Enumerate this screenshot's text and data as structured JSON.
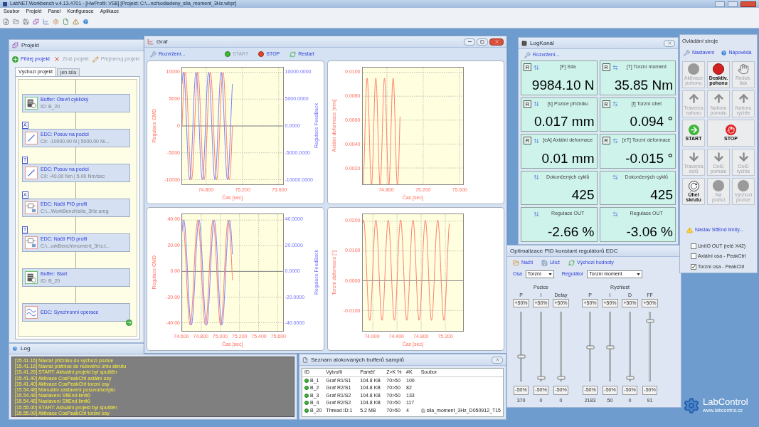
{
  "app": {
    "title": "LabNET.Workbench v.4.13.4701 -  [HwProfil: VS8] [Projekt: C:\\...nch\\odladeny_sila_moment_3Hz.wbpr]",
    "menu": [
      "Soubor",
      "Projekt",
      "Panel",
      "Konfigurace",
      "Aplikace"
    ]
  },
  "project": {
    "title": "Projekt",
    "actions": [
      {
        "label": "Přidej projekt",
        "kind": "add",
        "disabled": false
      },
      {
        "label": "Zruš projekt",
        "kind": "remove",
        "disabled": true
      },
      {
        "label": "Přejmenuj projekt",
        "kind": "rename",
        "disabled": true
      }
    ],
    "tabs": [
      {
        "label": "Výchozí projekt",
        "selected": true
      },
      {
        "label": "jen síla",
        "selected": false
      }
    ],
    "nodes": [
      {
        "kind": "buffer",
        "title": "Buffer: Otevři cyklický",
        "detail": "ID: B_20"
      },
      {
        "badge": "A",
        "kind": "move",
        "title": "EDC: Posuv na pozici",
        "detail": "Cíl: -10000.00 N | 5000.00 N/..."
      },
      {
        "badge": "T",
        "kind": "move",
        "title": "EDC: Posuv na pozici",
        "detail": "Cíl: -40.00 Nm | 5.00 Nm/sec"
      },
      {
        "badge": "A",
        "kind": "pid",
        "title": "EDC: Načti PID profil",
        "detail": "C:\\...WorkBench\\sila_3Hz.areg"
      },
      {
        "badge": "T",
        "kind": "pid",
        "title": "EDC: Načti PID profil",
        "detail": "C:\\...orkBench\\moment_3Hz.t..."
      },
      {
        "kind": "buffer",
        "title": "Buffer: Start",
        "detail": "ID: B_20"
      },
      {
        "kind": "sync",
        "title": "EDC: Synchronní operace",
        "next": true
      }
    ]
  },
  "graph": {
    "title": "Graf",
    "actions": [
      {
        "label": "Rozvržení...",
        "kind": "layout",
        "disabled": false
      },
      {
        "label": "START",
        "kind": "start",
        "disabled": true
      },
      {
        "label": "STOP",
        "kind": "stop",
        "disabled": false
      },
      {
        "label": "Restart",
        "kind": "restart",
        "disabled": false
      }
    ],
    "charts": [
      {
        "kind": "dual",
        "left_axis": {
          "title": "Regulace CMD",
          "ticks": [
            "10000",
            "5000",
            "0",
            "-5000",
            "-10000"
          ]
        },
        "right_axis": {
          "title": "Regulace FeedBack",
          "ticks": [
            "10000.0000",
            "5000.0000",
            "0.0000",
            "-5000.0000",
            "-10000.0000"
          ]
        },
        "bottom_axis": {
          "title": "Čas [sec]",
          "ticks": [
            "74.800",
            "75.200",
            "75.600"
          ]
        }
      },
      {
        "kind": "single",
        "left_axis": {
          "title": "Axiální deformace [mm]",
          "ticks": [
            "0.0100",
            "0.0080",
            "0.0060",
            "0.0040",
            "0.0020"
          ]
        },
        "bottom_axis": {
          "title": "Čas [sec]",
          "ticks": [
            "74.800",
            "75.200",
            "75.600"
          ]
        }
      },
      {
        "kind": "dual",
        "left_axis": {
          "title": "Regulace CMD",
          "ticks": [
            "40.00",
            "20.00",
            "0.00",
            "-20.00",
            "-40.00"
          ]
        },
        "right_axis": {
          "title": "Regulace FeedBack",
          "ticks": [
            "40.0000",
            "20.0000",
            "0.0000",
            "-20.0000",
            "-40.0000"
          ]
        },
        "bottom_axis": {
          "title": "Čas [sec]",
          "ticks": [
            "74.600",
            "74.800",
            "75.000",
            "75.200",
            "75.400",
            "75.600"
          ]
        }
      },
      {
        "kind": "single",
        "left_axis": {
          "title": "Torzní deformace [°]",
          "ticks": [
            "0.0200",
            "0.0100",
            "0.0000",
            "-0.0100"
          ]
        },
        "bottom_axis": {
          "title": "Čas [sec]",
          "ticks": [
            "74.000",
            "74.400",
            "74.800",
            "75.200"
          ]
        }
      }
    ]
  },
  "channels": {
    "title": "LogKanál",
    "action": "Rozvržení...",
    "tiles": [
      {
        "reset": "R",
        "kind": "axial",
        "label": "[F] Síla",
        "value": "9984.10 N"
      },
      {
        "reset": "R",
        "kind": "torsion",
        "label": "[T] Torzní moment",
        "value": "35.85 Nm"
      },
      {
        "reset": "R",
        "kind": "axial",
        "label": "[s] Pozice příčníku",
        "value": "0.017 mm"
      },
      {
        "reset": "R",
        "kind": "torsion",
        "label": "[f] Torzní úhel",
        "value": "0.094 °"
      },
      {
        "reset": "R",
        "kind": "axial",
        "label": "[eA] Axiální deformace",
        "value": "0.01 mm"
      },
      {
        "reset": "R",
        "kind": "torsion",
        "label": "[eT] Torzní deformace",
        "value": "-0.015 °"
      },
      {
        "kind": "axial",
        "label": "Dokončených cyklů",
        "value": "425"
      },
      {
        "kind": "torsion",
        "label": "Dokončených cyklů",
        "value": "425"
      },
      {
        "kind": "axial",
        "label": "Regulace OUT",
        "value": "-2.66 %"
      },
      {
        "kind": "torsion",
        "label": "Regulace OUT",
        "value": "-3.06 %"
      }
    ]
  },
  "control": {
    "title": "Ovládání stroje",
    "links": [
      {
        "label": "Nastavení",
        "kind": "settings"
      },
      {
        "label": "Nápověda",
        "kind": "help"
      }
    ],
    "buttons": [
      {
        "label": "Aktivace pohonu",
        "kind": "dot",
        "enabled": false
      },
      {
        "label": "Deaktiv. pohonu",
        "kind": "red-dot",
        "enabled": true
      },
      {
        "label": "Reduk. tlak",
        "kind": "pressure",
        "enabled": false
      },
      {
        "label": "Traverza nahoru",
        "kind": "up",
        "enabled": false
      },
      {
        "label": "Nahoru pomalu",
        "kind": "up",
        "enabled": false
      },
      {
        "label": "Nahoru rychle",
        "kind": "up",
        "enabled": false
      },
      {
        "label": "START",
        "kind": "start",
        "enabled": true
      },
      {
        "label": "STOP",
        "kind": "stop",
        "enabled": true
      },
      {
        "label": "Traverza dolů",
        "kind": "down",
        "enabled": false
      },
      {
        "label": "Dolů pomalu",
        "kind": "down",
        "enabled": false
      },
      {
        "label": "Dolů rychle",
        "kind": "down",
        "enabled": false
      },
      {
        "label": "Úhel skrutu",
        "kind": "rotate",
        "enabled": true
      },
      {
        "label": "Na pozici",
        "kind": "dot",
        "enabled": false
      },
      {
        "label": "Výchozí pozice",
        "kind": "dot",
        "enabled": false
      }
    ],
    "warning_link": "Nastav SftEnd limity...",
    "options": [
      {
        "label": "UniIO OUT (relé X42)",
        "checked": false
      },
      {
        "label": "Axiální osa - PeakCtrl",
        "checked": false
      },
      {
        "label": "Torzní osa - PeakCtrl",
        "checked": true
      }
    ]
  },
  "pid": {
    "title": "Optimalizace PID konstant regulátorů EDC",
    "actions": [
      {
        "label": "Načti",
        "kind": "open"
      },
      {
        "label": "Ulož",
        "kind": "save"
      },
      {
        "label": "Výchozí hodnoty",
        "kind": "reset"
      }
    ],
    "axis": {
      "label": "Osa",
      "value": "Torzní"
    },
    "regulator": {
      "label": "Regulátor",
      "value": "Torzní moment"
    },
    "groups": [
      {
        "title": "Pozice",
        "sliders": [
          {
            "label": "P",
            "plus": "+50%",
            "minus": "-50%",
            "value": "370",
            "level": 0.35
          },
          {
            "label": "I",
            "plus": "+50%",
            "minus": "-50%",
            "value": "0",
            "level": 0.04
          },
          {
            "label": "Delay",
            "plus": "+50%",
            "minus": "-50%",
            "value": "0",
            "level": 0.04
          }
        ]
      },
      {
        "title": "Rychlost",
        "sliders": [
          {
            "label": "P",
            "plus": "+50%",
            "minus": "-50%",
            "value": "2183",
            "level": 0.49
          },
          {
            "label": "I",
            "plus": "+50%",
            "minus": "-50%",
            "value": "50",
            "level": 0.49
          },
          {
            "label": "D",
            "plus": "+50%",
            "minus": "-50%",
            "value": "0",
            "level": 0.04
          },
          {
            "label": "FF",
            "plus": "+50%",
            "minus": "-50%",
            "value": "91",
            "level": 0.87
          }
        ]
      }
    ]
  },
  "log": {
    "title": "Log",
    "entries": [
      "[15.41.16] Návrat příčníku do výchozí pozice",
      "[15.41.16] Návrat pístnice do nulového úhlu skrutu",
      "[15.41.26] START: Aktuální projekt byl spuštěn",
      "[15.41.40] Aktivace CosPeakCtrl axiální osy",
      "[15.41.40] Aktivace CosPeakCtrl torzní osy",
      "[15.54.48] Manuální zastavení posuvu/scriptu",
      "[15.54.48] Nastavení SftEnd limitů",
      "[15.54.48] Nastavení SftEnd limitů",
      "[15.55.00] START: Aktuální projekt byl spuštěn",
      "[15.55.09] Aktivace CosPeakCtrl torzní osy"
    ]
  },
  "buffers": {
    "title": "Seznam alokovaných bufferů samplů",
    "columns": [
      "ID",
      "Vytvořil",
      "Paměť",
      "Z>K %",
      "#K",
      "Soubor"
    ],
    "rows": [
      {
        "cells": [
          "B_1",
          "Graf R1/S1",
          "104.8 KB",
          "70>50",
          "100"
        ]
      },
      {
        "cells": [
          "B_2",
          "Graf R2/S1",
          "104.8 KB",
          "70>50",
          "82"
        ]
      },
      {
        "cells": [
          "B_3",
          "Graf R1/S2",
          "104.8 KB",
          "70>50",
          "133"
        ]
      },
      {
        "cells": [
          "B_4",
          "Graf R2/S2",
          "104.8 KB",
          "70>50",
          "117"
        ]
      },
      {
        "cells": [
          "B_20",
          "Thread ID:1",
          "5.2 MB",
          "70>50",
          "4"
        ],
        "file": "sila_moment_3Hz_D050912_T15"
      }
    ]
  },
  "logo": {
    "name": "LabControl",
    "url": "www.labcontrol.cz"
  }
}
